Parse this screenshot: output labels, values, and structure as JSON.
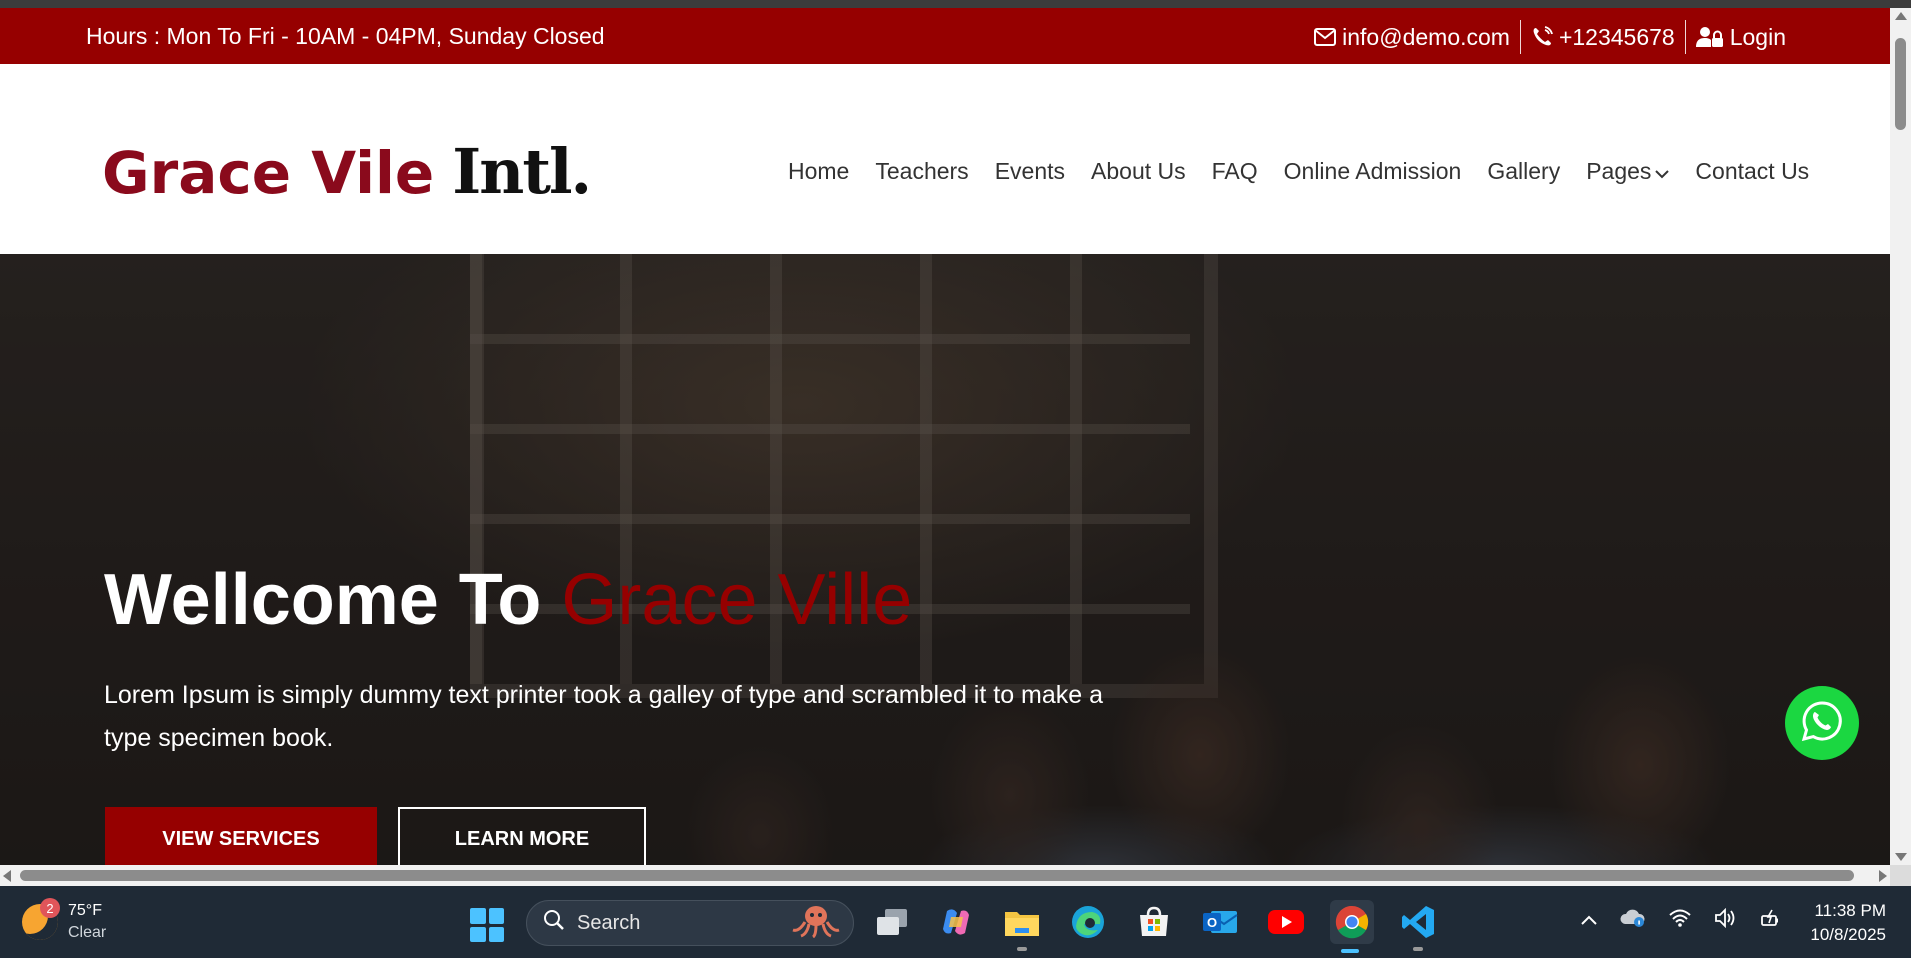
{
  "topbar": {
    "hours": "Hours : Mon To Fri - 10AM - 04PM, Sunday Closed",
    "email": "info@demo.com",
    "phone": "+12345678",
    "login": "Login"
  },
  "header": {
    "logo_part1": "Grace  Vile",
    "logo_part2": "Intl.",
    "nav": [
      "Home",
      "Teachers",
      "Events",
      "About Us",
      "FAQ",
      "Online Admission",
      "Gallery",
      "Pages",
      "Contact Us"
    ]
  },
  "hero": {
    "title_prefix": "Wellcome To ",
    "title_accent": "Grace Ville",
    "description": "Lorem Ipsum is simply dummy text printer took a galley of type and scrambled it to make a type specimen book.",
    "primary_button": "VIEW SERVICES",
    "secondary_button": "LEARN MORE"
  },
  "colors": {
    "brand": "#960000",
    "whatsapp": "#1bd741"
  },
  "taskbar": {
    "weather_temp": "75°F",
    "weather_cond": "Clear",
    "weather_badge": "2",
    "search_label": "Search",
    "time": "11:38 PM",
    "date": "10/8/2025"
  }
}
